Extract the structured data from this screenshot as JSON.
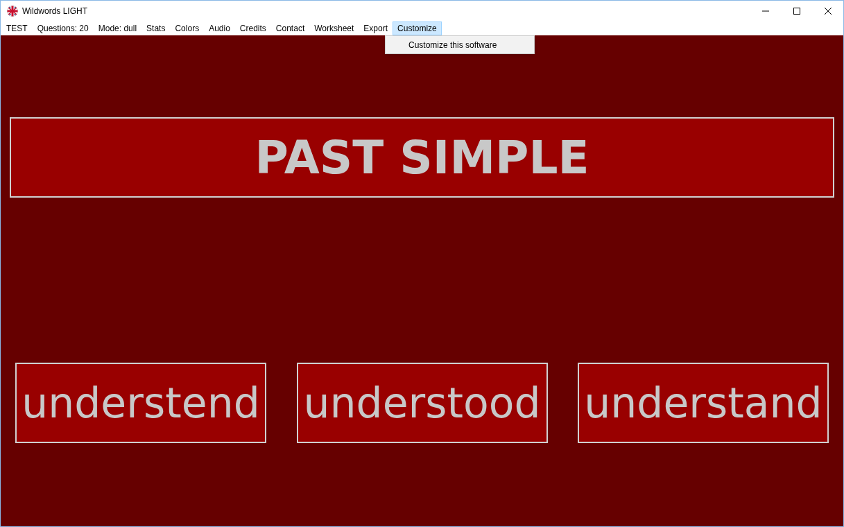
{
  "window": {
    "title": "Wildwords LIGHT"
  },
  "menu": [
    {
      "label": "TEST",
      "selected": false
    },
    {
      "label": "Questions: 20",
      "selected": false
    },
    {
      "label": "Mode: dull",
      "selected": false
    },
    {
      "label": "Stats",
      "selected": false
    },
    {
      "label": "Colors",
      "selected": false
    },
    {
      "label": "Audio",
      "selected": false
    },
    {
      "label": "Credits",
      "selected": false
    },
    {
      "label": "Contact",
      "selected": false
    },
    {
      "label": "Worksheet",
      "selected": false
    },
    {
      "label": "Export",
      "selected": false
    },
    {
      "label": "Customize",
      "selected": true
    }
  ],
  "dropdown": {
    "items": [
      "Customize this software"
    ]
  },
  "question": {
    "prompt": "PAST SIMPLE"
  },
  "answers": [
    {
      "label": "understend"
    },
    {
      "label": "understood"
    },
    {
      "label": "understand"
    }
  ]
}
